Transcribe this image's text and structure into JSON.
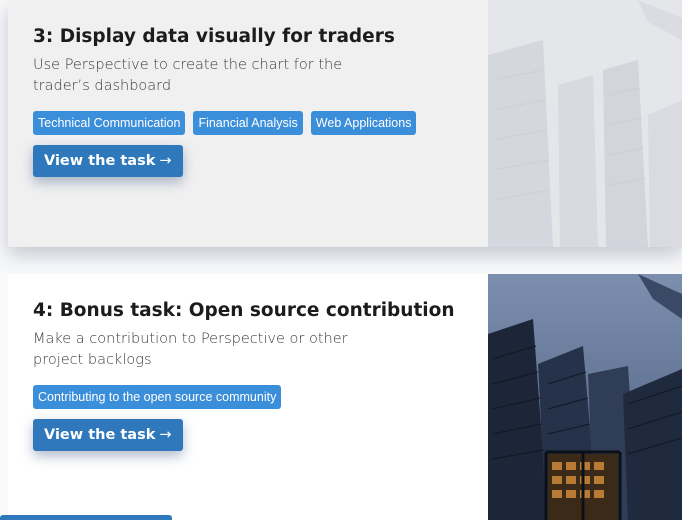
{
  "tasks": [
    {
      "title": "3: Display data visually for traders",
      "description": "Use Perspective to create the chart for the trader’s dashboard",
      "tags": [
        "Technical Communication",
        "Financial Analysis",
        "Web Applications"
      ],
      "button_label": "View the task",
      "button_arrow": "→",
      "image": "city-skyscrapers-photo-faded"
    },
    {
      "title": "4: Bonus task: Open source contribution",
      "description": "Make a contribution to Perspective or other project backlogs",
      "tags": [
        "Contributing to the open source community"
      ],
      "button_label": "View the task",
      "button_arrow": "→",
      "image": "city-skyscrapers-photo"
    }
  ],
  "colors": {
    "tag_bg": "#3b8ed9",
    "button_bg": "#2e78bb",
    "faded_card_bg": "#f0f0f1"
  }
}
